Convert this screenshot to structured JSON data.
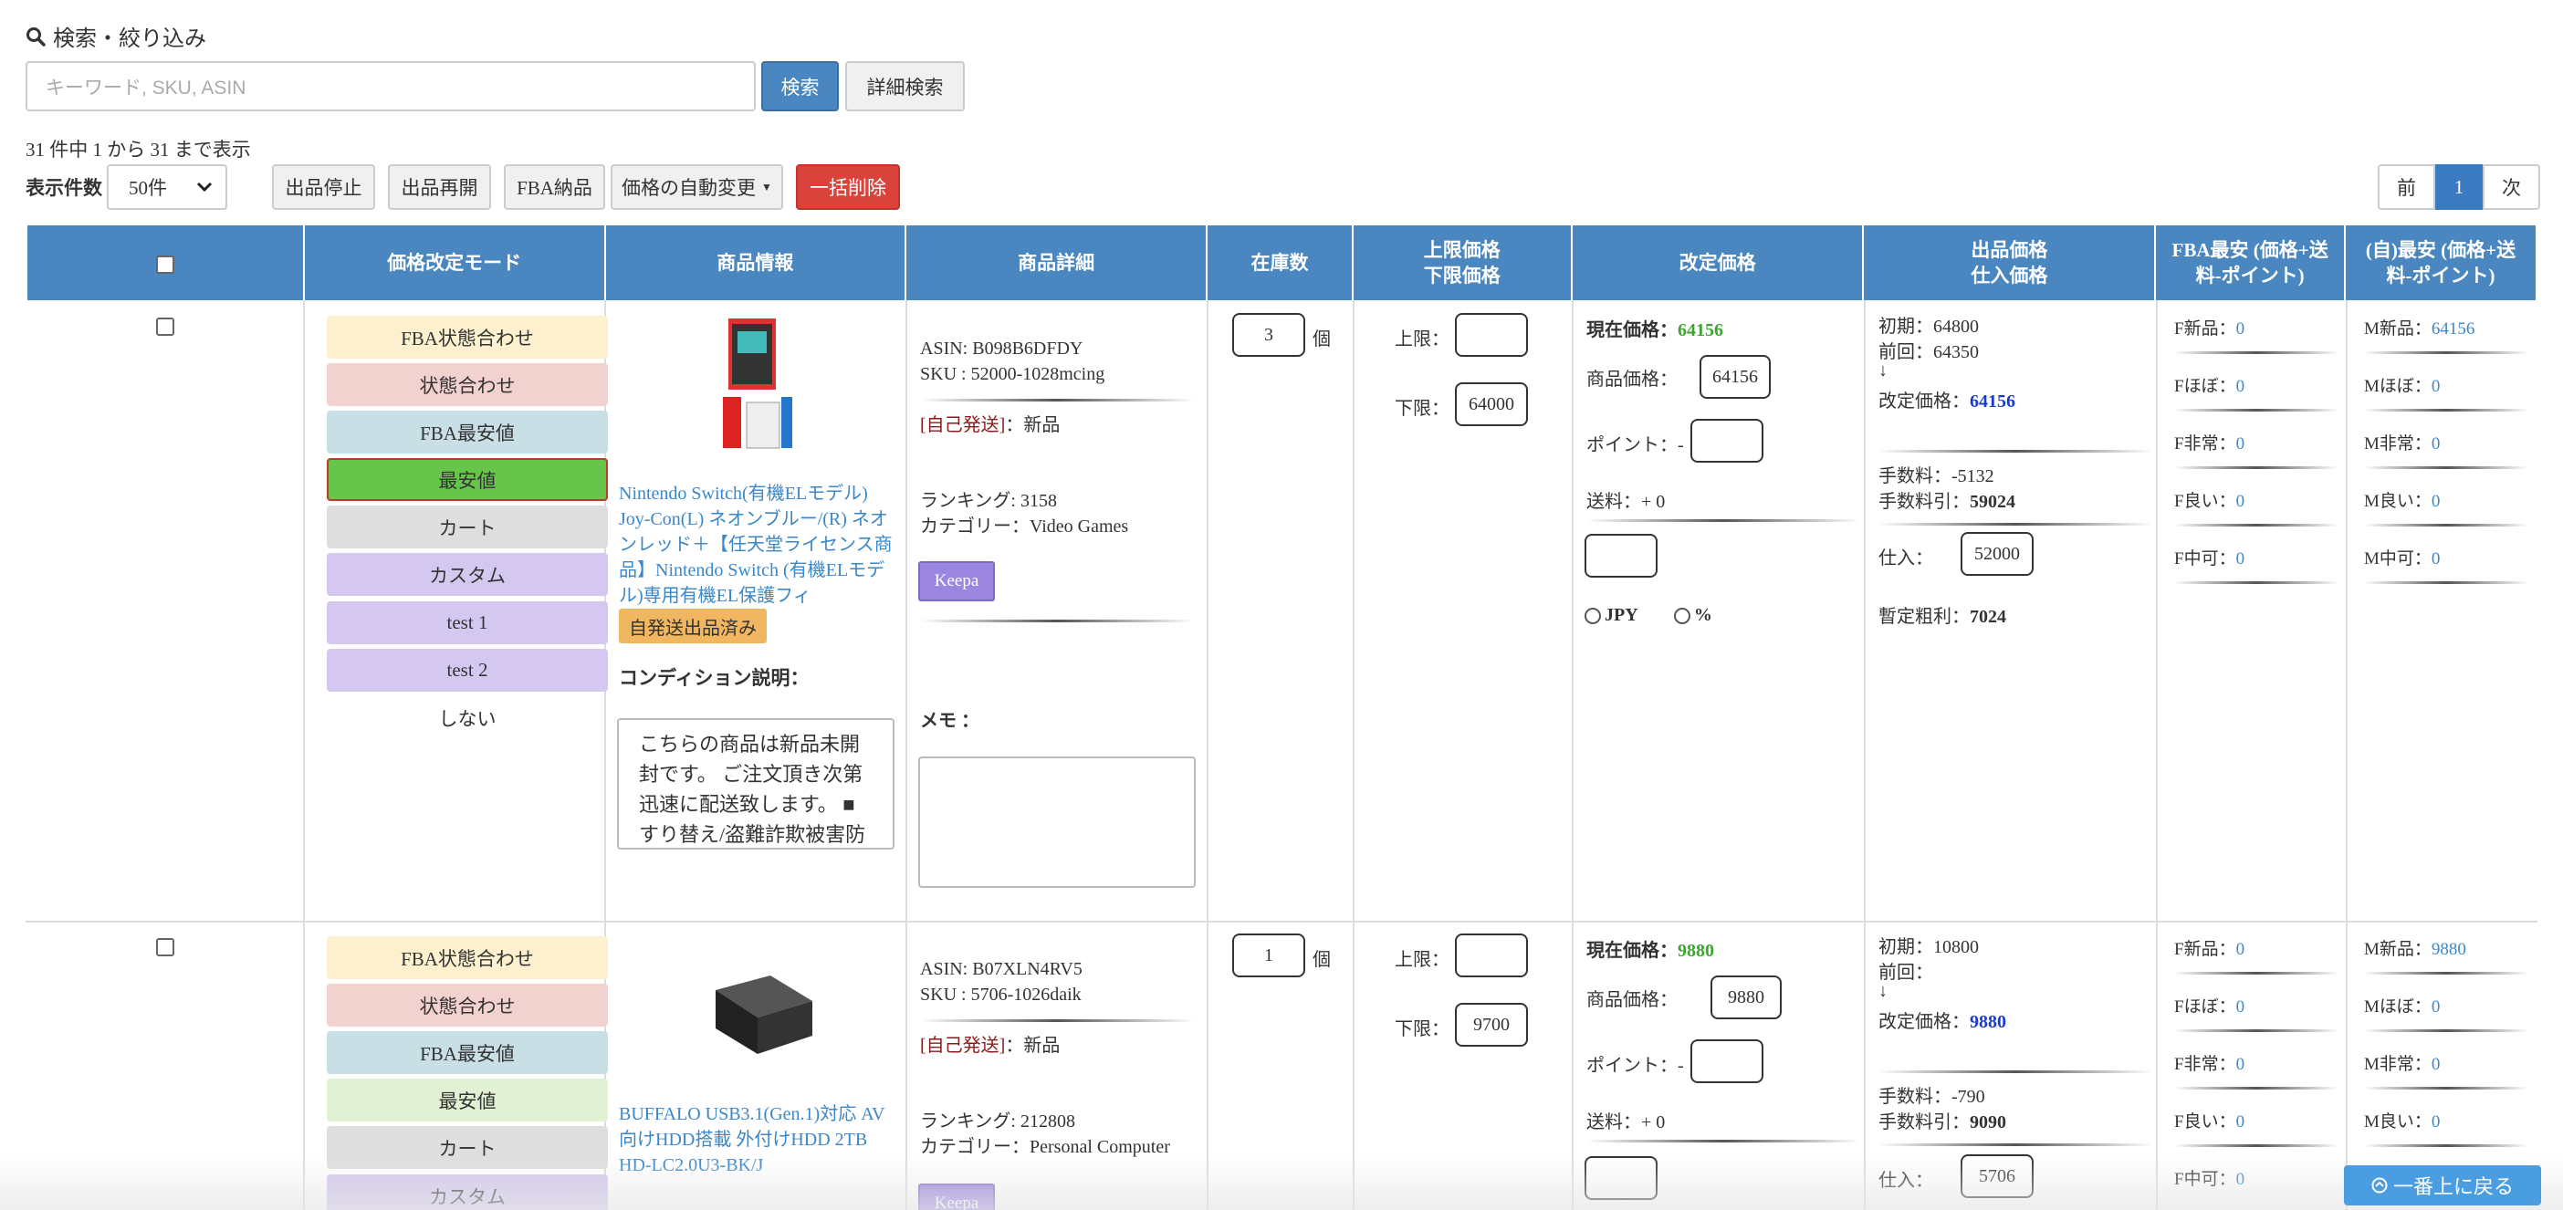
{
  "header": {
    "title": "検索・絞り込み"
  },
  "search": {
    "placeholder": "キーワード, SKU, ASIN",
    "search_label": "検索",
    "advanced_label": "詳細検索"
  },
  "listing": {
    "info": "31 件中 1 から 31 まで表示",
    "perpage_label": "表示件数",
    "perpage_value": "50件"
  },
  "actions": {
    "stop": "出品停止",
    "resume": "出品再開",
    "fba": "FBA納品",
    "auto_price": "価格の自動変更",
    "bulk_delete": "一括削除"
  },
  "pager": {
    "prev": "前",
    "current": "1",
    "next": "次"
  },
  "columns": {
    "mode": "価格改定モード",
    "product_info": "商品情報",
    "product_detail": "商品詳細",
    "stock": "在庫数",
    "limit_upper": "上限価格",
    "limit_lower": "下限価格",
    "revise": "改定価格",
    "listing_price": "出品価格",
    "purchase_price": "仕入価格",
    "fba_min": "FBA最安 (価格+送",
    "fba_min2": "料-ポイント)",
    "self_min": "(自)最安 (価格+送",
    "self_min2": "料-ポイント)"
  },
  "modes": [
    "FBA状態合わせ",
    "状態合わせ",
    "FBA最安値",
    "最安値",
    "カート",
    "カスタム",
    "test 1",
    "test 2",
    "しない"
  ],
  "labels": {
    "unit": "個",
    "upper": "上限：",
    "lower": "下限：",
    "current_price": "現在価格：",
    "item_price": "商品価格：",
    "point": "ポイント：-",
    "shipping": "送料：+ 0",
    "jpy": "JPY",
    "pct": "%",
    "self_ship": "[自己発送]",
    "new": "：新品",
    "keepa": "Keepa",
    "self_listed": "自発送出品済み",
    "condition": "コンディション説明：",
    "memo": "メモ ：",
    "ranking": "ランキング: ",
    "category": "カテゴリー：",
    "initial": "初期：",
    "previous": "前回：",
    "arrow": "↓",
    "revised": "改定価格：",
    "fee": "手数料：",
    "fee_deducted": "手数料引：",
    "purchase": "仕入：",
    "est_profit": "暫定粗利：",
    "f_new": "F新品：",
    "f_almost": "Fほぼ：",
    "f_very": "F非常：",
    "f_good": "F良い：",
    "f_ok": "F中可：",
    "m_new": "M新品：",
    "m_almost": "Mほぼ：",
    "m_very": "M非常：",
    "m_good": "M良い：",
    "m_ok": "M中可：",
    "m_ok_cut": "M中",
    "back_top": "一番上に戻る"
  },
  "rows": [
    {
      "asin": "ASIN: B098B6DFDY",
      "sku": "SKU : 52000-1028mcing",
      "title": "Nintendo Switch(有機ELモデル) Joy-Con(L) ネオンブルー/(R) ネオンレッド＋【任天堂ライセンス商品】Nintendo Switch (有機ELモデル)専用有機EL保護フィ",
      "ranking": "3158",
      "category": "Video Games",
      "condition_text": "こちらの商品は新品未開封です。 ご注文頂き次第迅速に配送致します。 ■ すり替え/盗難詐欺被害防",
      "stock": "3",
      "upper": "",
      "lower": "64000",
      "current_price": "64156",
      "item_price": "64156",
      "initial": "64800",
      "previous": "64350",
      "revised": "64156",
      "fee": "-5132",
      "fee_deducted": "59024",
      "purchase": "52000",
      "profit": "7024",
      "f": [
        "0",
        "0",
        "0",
        "0",
        "0"
      ],
      "m": [
        "64156",
        "0",
        "0",
        "0",
        "0"
      ]
    },
    {
      "asin": "ASIN: B07XLN4RV5",
      "sku": "SKU : 5706-1026daik",
      "title": "BUFFALO USB3.1(Gen.1)対応 AV向けHDD搭載 外付けHDD 2TB HD-LC2.0U3-BK/J",
      "ranking": "212808",
      "category": "Personal Computer",
      "stock": "1",
      "upper": "",
      "lower": "9700",
      "current_price": "9880",
      "item_price": "9880",
      "initial": "10800",
      "previous": "",
      "revised": "9880",
      "fee": "-790",
      "fee_deducted": "9090",
      "purchase": "5706",
      "f": [
        "0",
        "0",
        "0",
        "0",
        "0"
      ],
      "m": [
        "9880",
        "0",
        "0",
        "0"
      ]
    }
  ]
}
